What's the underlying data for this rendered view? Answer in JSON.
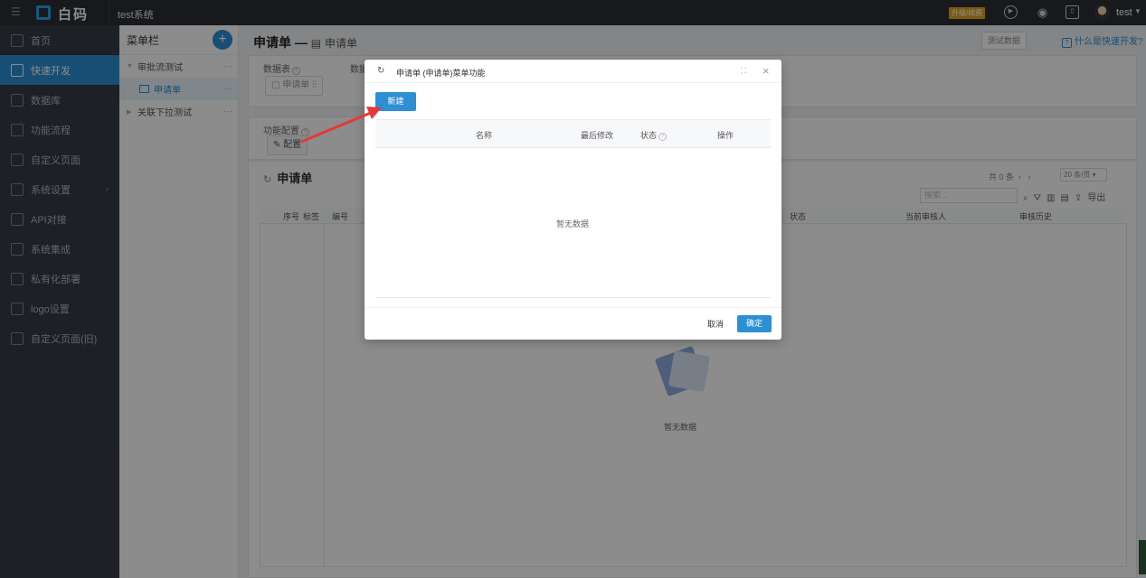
{
  "topbar": {
    "logo_text": "白码",
    "system_name": "test系统",
    "upgrade_badge": "升级/续费",
    "user": "test"
  },
  "sidebar": {
    "items": [
      {
        "label": "首页",
        "icon": "home-icon"
      },
      {
        "label": "快速开发",
        "icon": "cube-icon"
      },
      {
        "label": "数据库",
        "icon": "database-icon"
      },
      {
        "label": "功能流程",
        "icon": "flow-icon"
      },
      {
        "label": "自定义页面",
        "icon": "page-icon"
      },
      {
        "label": "系统设置",
        "icon": "settings-icon"
      },
      {
        "label": "API对接",
        "icon": "api-icon"
      },
      {
        "label": "系统集成",
        "icon": "integration-icon"
      },
      {
        "label": "私有化部署",
        "icon": "deploy-icon"
      },
      {
        "label": "logo设置",
        "icon": "logo-icon"
      },
      {
        "label": "自定义页面(旧)",
        "icon": "page-old-icon"
      }
    ]
  },
  "menu_panel": {
    "title": "菜单栏",
    "tree": [
      {
        "label": "审批流测试",
        "level": 0
      },
      {
        "label": "申请单",
        "level": 1
      },
      {
        "label": "关联下拉测试",
        "level": 0
      }
    ]
  },
  "main": {
    "title": "申请单",
    "dash": "—",
    "subtitle": "申请单",
    "test_data_btn": "测试数据",
    "help_link": "什么是快速开发?",
    "datatable_label": "数据表",
    "datarel_label": "数据",
    "datatable_pill": "申请单",
    "func_config_label": "功能配置",
    "config_btn": "配置",
    "table_title": "申请单",
    "pager_total": "共 0 条",
    "page_size": "20 条/页",
    "search_placeholder": "搜索...",
    "export": "导出",
    "columns": [
      "序号",
      "标签",
      "编号",
      "状态",
      "当前审核人",
      "审核历史"
    ],
    "empty_text": "暂无数据"
  },
  "modal": {
    "title": "申请单 (申请单)菜单功能",
    "new_btn": "新建",
    "columns": [
      "名称",
      "最后修改",
      "状态",
      "操作"
    ],
    "empty_text": "暂无数据",
    "cancel": "取消",
    "ok": "确定"
  },
  "colors": {
    "accent": "#2d8fd4",
    "sidebar_bg": "#363b44",
    "topbar_bg": "#2b2f36",
    "upgrade": "#e8a317",
    "annotation_arrow": "#e53935"
  }
}
